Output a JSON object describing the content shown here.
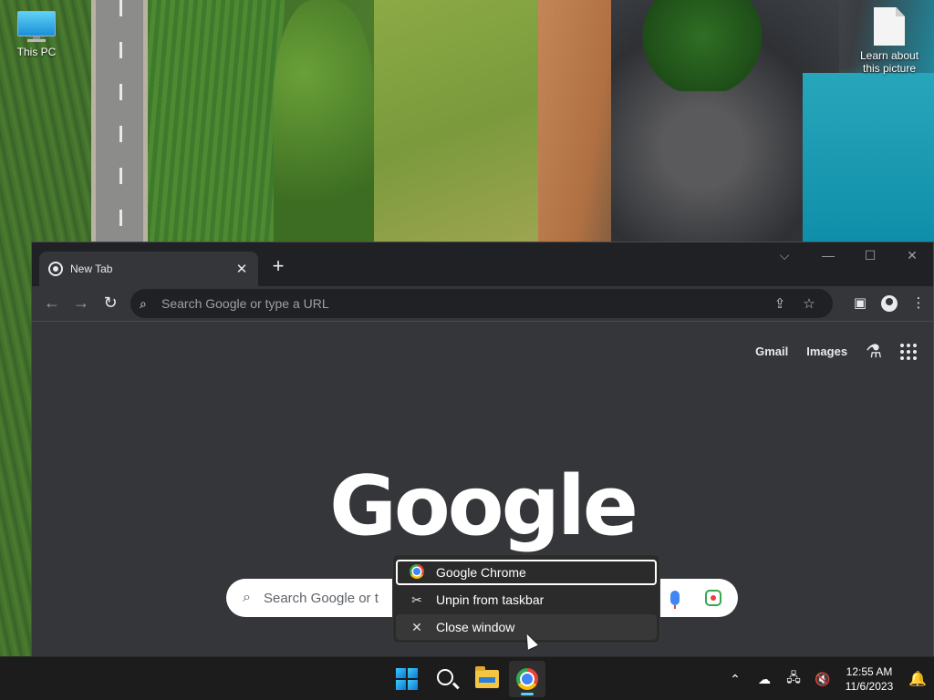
{
  "desktop": {
    "icons": [
      {
        "label": "This PC"
      },
      {
        "label": "Learn about this picture"
      }
    ]
  },
  "browser": {
    "tab_title": "New Tab",
    "tab_close": "✕",
    "new_tab": "+",
    "window_controls": {
      "dropdown": "⌵",
      "minimize": "—",
      "maximize": "☐",
      "close": "✕"
    },
    "nav": {
      "back": "←",
      "forward": "→",
      "reload": "↻"
    },
    "omnibox_placeholder": "Search Google or type a URL",
    "toolbar_icons": {
      "share": "⇪",
      "bookmark": "☆",
      "side_panel": "▣",
      "menu": "⋮"
    }
  },
  "new_tab_page": {
    "links": {
      "gmail": "Gmail",
      "images": "Images",
      "labs": "⚗"
    },
    "logo": "Google",
    "search_placeholder": "Search Google or t"
  },
  "jump_list": {
    "items": [
      {
        "label": "Google Chrome",
        "icon": "chrome-icon"
      },
      {
        "label": "Unpin from taskbar",
        "icon": "unpin-icon",
        "glyph": "✂"
      },
      {
        "label": "Close window",
        "icon": "close-icon",
        "glyph": "✕"
      }
    ]
  },
  "taskbar": {
    "tray": {
      "chevron": "⌃",
      "onedrive": "☁",
      "network": "🖧",
      "volume": "🔇",
      "notifications": "🔔"
    },
    "time": "12:55 AM",
    "date": "11/6/2023"
  },
  "colors": {
    "accent": "#60cdff",
    "chrome_bg": "#35363a",
    "taskbar_bg": "#1c1c1c"
  }
}
